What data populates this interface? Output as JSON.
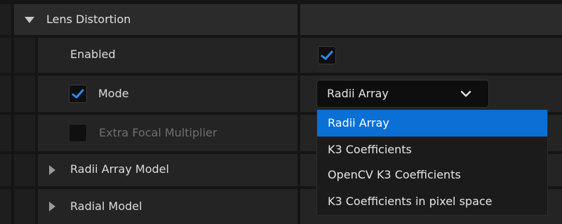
{
  "section": {
    "title": "Lens Distortion",
    "expanded": true
  },
  "properties": {
    "enabled": {
      "label": "Enabled",
      "checked": true
    },
    "mode": {
      "label": "Mode",
      "checked": true,
      "value": "Radii Array"
    },
    "extra_focal": {
      "label": "Extra Focal Multiplier",
      "checked": false,
      "disabled": true
    },
    "radii_array_model": {
      "label": "Radii Array Model"
    },
    "radial_model": {
      "label": "Radial Model"
    }
  },
  "dropdown": {
    "selected_index": 0,
    "options": [
      {
        "label": "Radii Array"
      },
      {
        "label": "K3 Coefficients"
      },
      {
        "label": "OpenCV K3 Coefficients"
      },
      {
        "label": "K3 Coefficients in pixel space"
      }
    ]
  },
  "colors": {
    "accent": "#0a70d6",
    "check": "#2b8cff",
    "panel": "#242424",
    "background": "#151515"
  }
}
